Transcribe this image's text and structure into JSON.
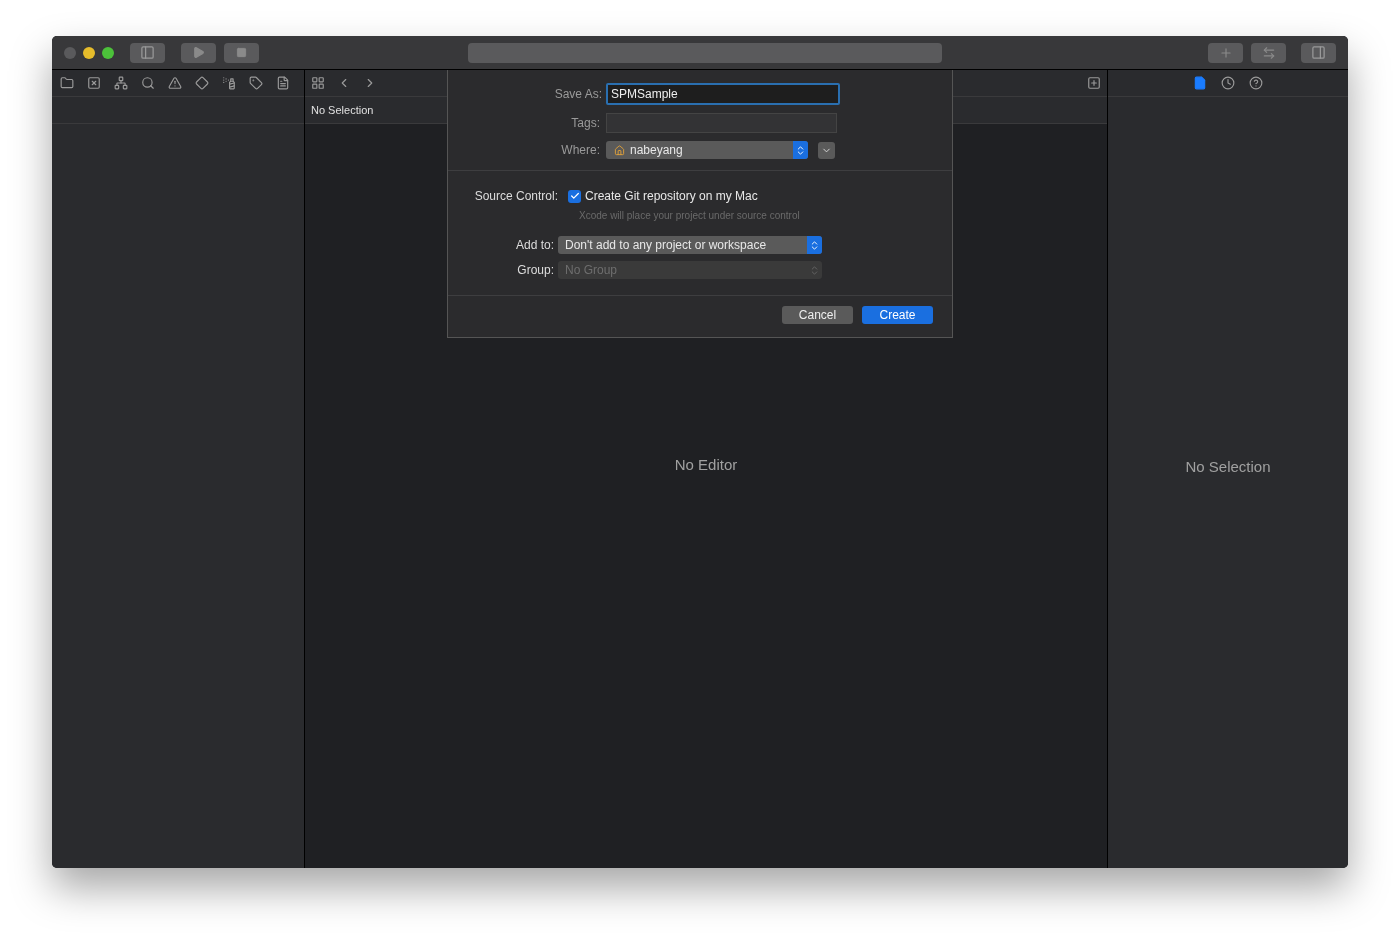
{
  "editor": {
    "jump_bar": "No Selection",
    "placeholder": "No Editor"
  },
  "inspector": {
    "tabs": [
      {
        "kind": "file",
        "selected": true
      },
      {
        "kind": "history",
        "selected": false
      },
      {
        "kind": "help",
        "selected": false
      }
    ],
    "placeholder": "No Selection"
  },
  "dialog": {
    "save_as": {
      "label": "Save As:",
      "value": "SPMSample"
    },
    "tags": {
      "label": "Tags:"
    },
    "where": {
      "label": "Where:",
      "value": "nabeyang"
    },
    "source_control": {
      "label": "Source Control:",
      "checkbox": "Create Git repository on my Mac",
      "checked": true,
      "hint": "Xcode will place your project under source control"
    },
    "add_to": {
      "label": "Add to:",
      "value": "Don't add to any project or workspace",
      "disabled": false
    },
    "group": {
      "label": "Group:",
      "value": "No Group",
      "disabled": true
    },
    "buttons": [
      {
        "label": "Cancel",
        "kind": "secondary"
      },
      {
        "label": "Create",
        "kind": "primary"
      }
    ]
  }
}
